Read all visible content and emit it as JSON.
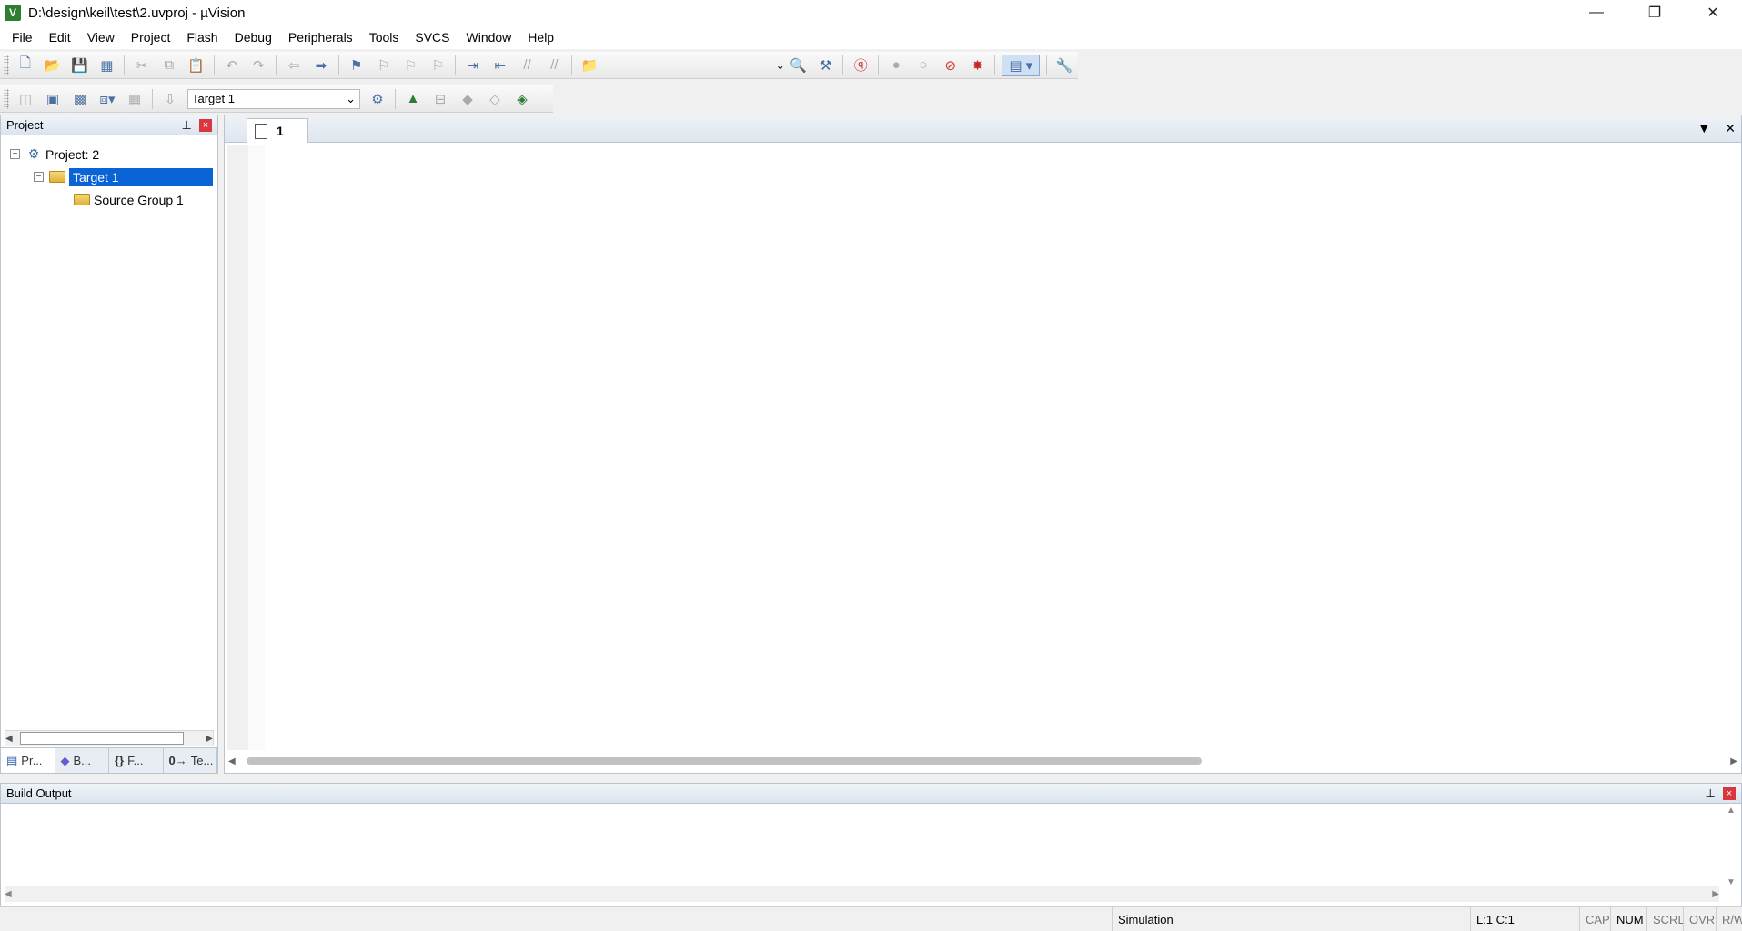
{
  "window": {
    "title": "D:\\design\\keil\\test\\2.uvproj - µVision",
    "app_icon": "V"
  },
  "window_controls": {
    "minimize": "—",
    "maximize": "❐",
    "close": "✕"
  },
  "menu": [
    "File",
    "Edit",
    "View",
    "Project",
    "Flash",
    "Debug",
    "Peripherals",
    "Tools",
    "SVCS",
    "Window",
    "Help"
  ],
  "toolbar": {
    "target_select": "Target 1"
  },
  "project_panel": {
    "title": "Project",
    "pin": "⊥",
    "close": "×",
    "tree": {
      "project": "Project: 2",
      "target": "Target 1",
      "group": "Source Group 1"
    },
    "tabs": [
      {
        "glyph": "▤",
        "label": "Pr..."
      },
      {
        "glyph": "◆",
        "label": "B..."
      },
      {
        "glyph": "{}",
        "label": "F..."
      },
      {
        "glyph": "0→",
        "label": "Te..."
      }
    ]
  },
  "editor": {
    "tab_label": "1"
  },
  "build_output": {
    "title": "Build Output"
  },
  "statusbar": {
    "mode": "Simulation",
    "position": "L:1 C:1",
    "cap": "CAP",
    "num": "NUM",
    "scrl": "SCRL",
    "ovr": "OVR",
    "rw": "R/W"
  }
}
